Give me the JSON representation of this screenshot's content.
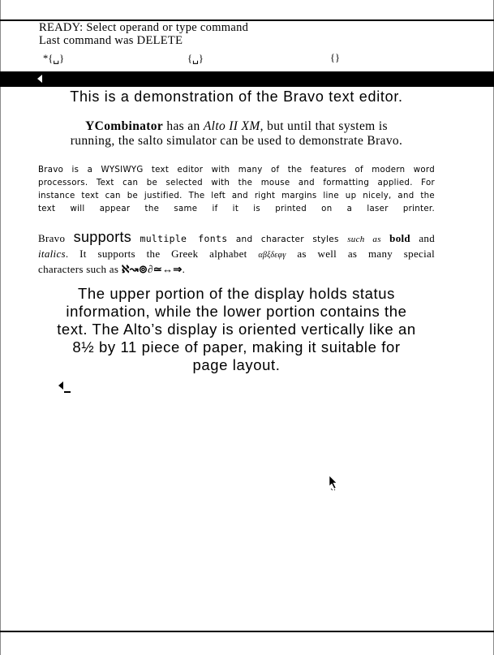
{
  "status": {
    "line1": "READY: Select operand or type command",
    "line2": "Last command was DELETE"
  },
  "format_bar": [
    "*{␣}",
    "{␣}",
    "{}"
  ],
  "document": {
    "title": "This is a demonstration of the Bravo text editor.",
    "p1": {
      "bold": "YCombinator",
      "a": " has an ",
      "italic": "Alto II XM",
      "line1_end": ", but until that system is",
      "line2": "running, the salto simulator can be used to demonstrate Bravo."
    },
    "p2_lines": [
      "Bravo is a WYSIWYG text editor with many of the features of modern word",
      "processors. Text can be selected with the mouse and formatting applied. For",
      "instance text can be justified. The left and right margins line up nicely, and the",
      "text will appear the same if it is printed on a laser printer."
    ],
    "p3": {
      "w1": "Bravo",
      "w2": "supports",
      "w3": "multiple fonts",
      "w4": "and character styles",
      "w5": "such as",
      "bold": "bold",
      "and": "and",
      "italic": "italics",
      "line2_a": ". It supports the Greek alphabet ",
      "greek": "αβξδεφγ",
      "line2_b": " as well as many special",
      "line3_a": "characters such as ",
      "symbols": "ℵ↝⊚∂≃↔⇒",
      "line3_b": "."
    },
    "p4_lines": [
      "The upper portion of the display holds status",
      "information, while the lower portion contains the",
      "text. The Alto’s display is oriented vertically like an",
      "8½ by 11 piece of paper, making it suitable for",
      "page layout."
    ]
  },
  "icons": [
    "left-arrow-icon",
    "end-of-document-icon",
    "mouse-pointer-icon"
  ]
}
